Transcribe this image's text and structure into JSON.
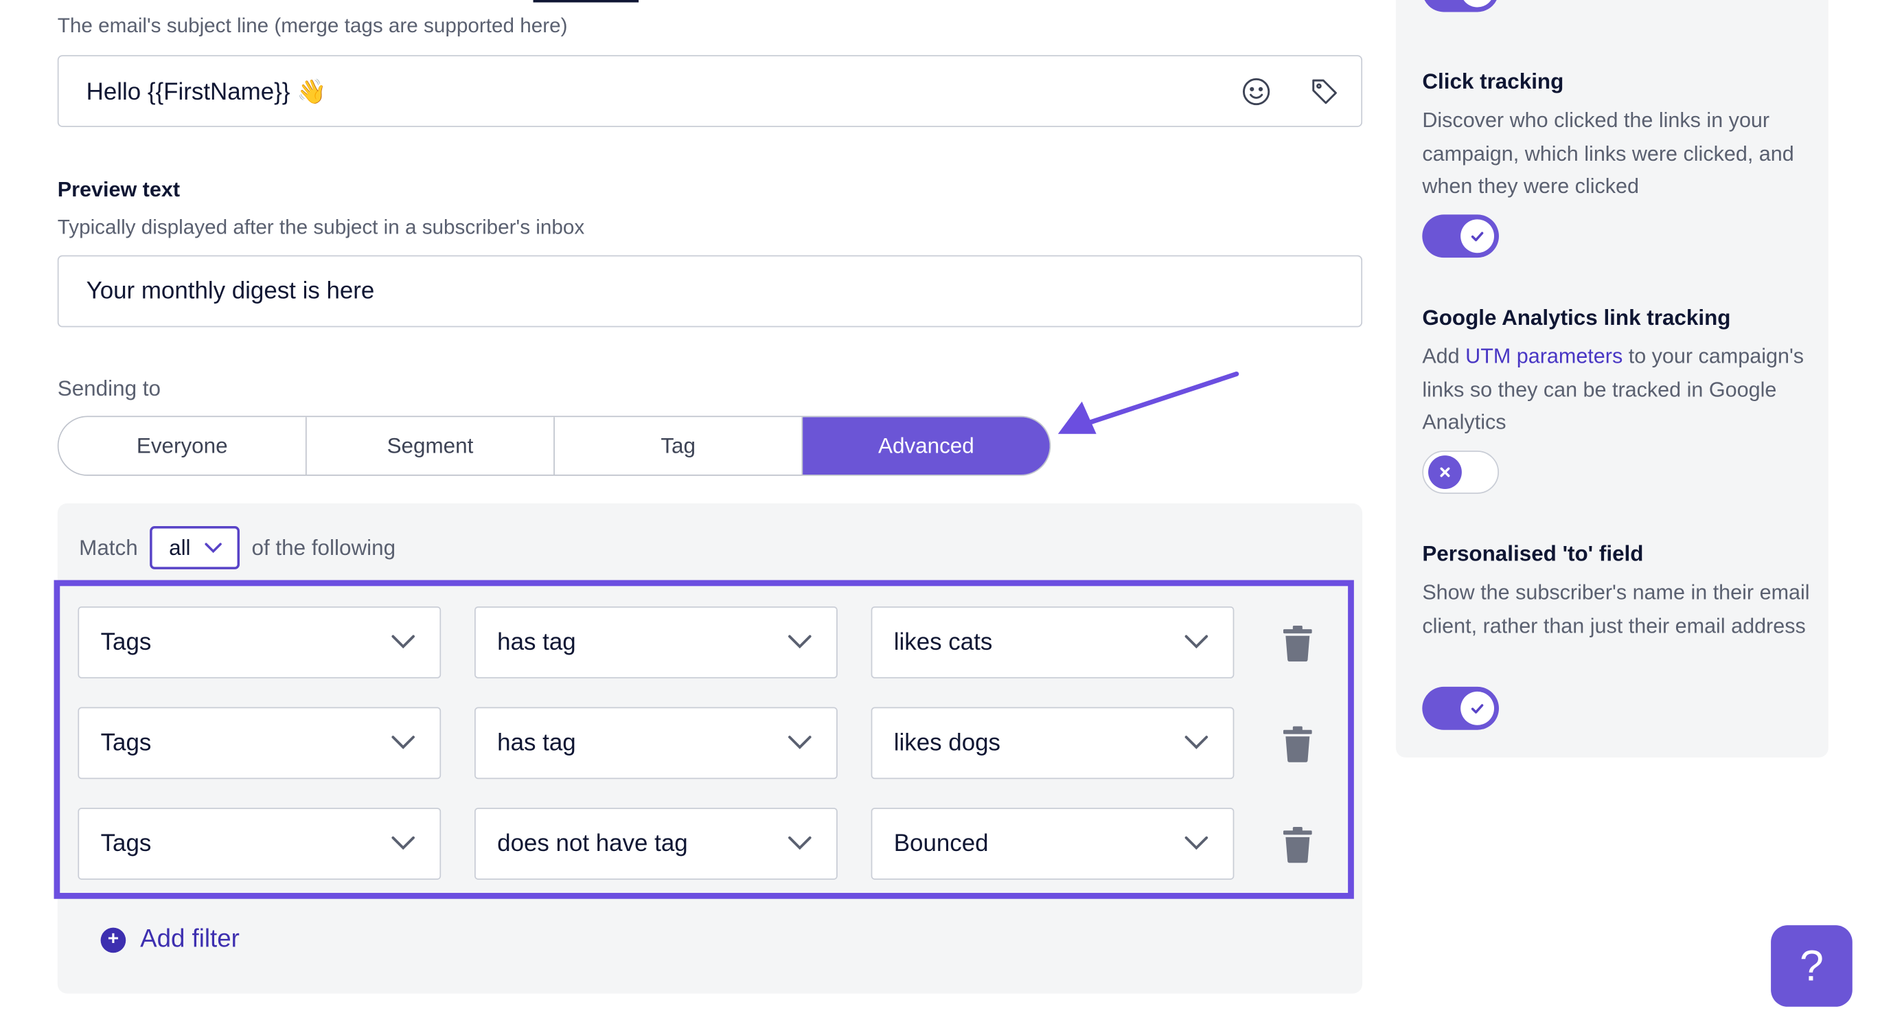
{
  "subject": {
    "hint": "The email's subject line (merge tags are supported here)",
    "value": "Hello {{FirstName}} 👋"
  },
  "preview": {
    "label": "Preview text",
    "hint": "Typically displayed after the subject in a subscriber's inbox",
    "value": "Your monthly digest is here"
  },
  "sending": {
    "label": "Sending to",
    "options": [
      "Everyone",
      "Segment",
      "Tag",
      "Advanced"
    ],
    "active": "Advanced"
  },
  "match": {
    "prefix": "Match",
    "value": "all",
    "suffix": "of the following"
  },
  "filters": [
    {
      "field": "Tags",
      "operator": "has tag",
      "value": "likes cats"
    },
    {
      "field": "Tags",
      "operator": "has tag",
      "value": "likes dogs"
    },
    {
      "field": "Tags",
      "operator": "does not have tag",
      "value": "Bounced"
    }
  ],
  "add_filter_label": "Add filter",
  "sidebar": {
    "click_tracking": {
      "title": "Click tracking",
      "desc": "Discover who clicked the links in your campaign, which links were clicked, and when they were clicked",
      "enabled": true
    },
    "ga_tracking": {
      "title": "Google Analytics link tracking",
      "desc_before": "Add ",
      "desc_link": "UTM parameters",
      "desc_after": " to your campaign's links so they can be tracked in Google Analytics",
      "enabled": false
    },
    "personalised_to": {
      "title": "Personalised 'to' field",
      "desc": "Show the subscriber's name in their email client, rather than just their email address",
      "enabled": true
    }
  },
  "help_label": "?",
  "colors": {
    "accent": "#6b55d6",
    "highlight": "#6b4ee0",
    "link": "#4836c4"
  }
}
